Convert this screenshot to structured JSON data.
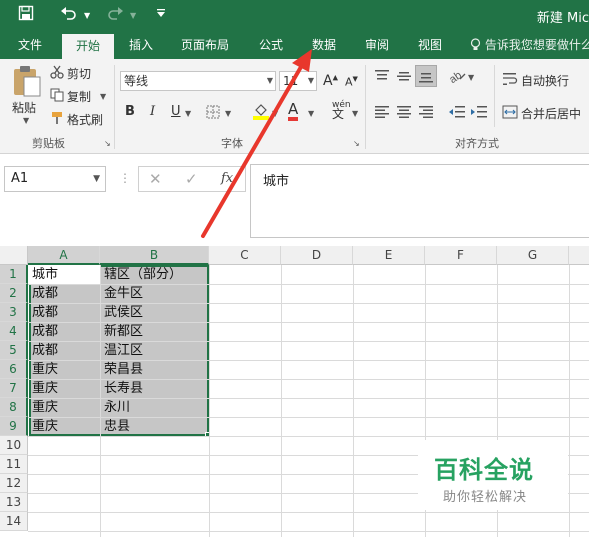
{
  "window": {
    "title": "新建 Mic"
  },
  "quick_access": {
    "save_icon": "save-icon",
    "undo_icon": "undo-icon",
    "redo_icon": "redo-icon",
    "customize_icon": "customize-icon"
  },
  "tabs": [
    {
      "label": "文件"
    },
    {
      "label": "开始"
    },
    {
      "label": "插入"
    },
    {
      "label": "页面布局"
    },
    {
      "label": "公式"
    },
    {
      "label": "数据"
    },
    {
      "label": "审阅"
    },
    {
      "label": "视图"
    }
  ],
  "tell_me": "告诉我您想要做什么",
  "ribbon": {
    "clipboard": {
      "paste": "粘贴",
      "cut": "剪切",
      "copy": "复制",
      "format_painter": "格式刷",
      "label": "剪贴板"
    },
    "font": {
      "name": "等线",
      "size": "11",
      "bold": "B",
      "italic": "I",
      "underline": "U",
      "font_color": "A",
      "phonetic": "wén",
      "label": "字体",
      "grow": "A",
      "shrink": "A"
    },
    "alignment": {
      "wrap": "自动换行",
      "merge": "合并后居中",
      "label": "对齐方式"
    }
  },
  "formula_bar": {
    "name_box": "A1",
    "fx": "fx",
    "cancel": "✕",
    "enter": "✓",
    "formula": "城市"
  },
  "grid": {
    "columns": [
      "A",
      "B",
      "C",
      "D",
      "E",
      "F",
      "G"
    ],
    "rows": [
      "1",
      "2",
      "3",
      "4",
      "5",
      "6",
      "7",
      "8",
      "9",
      "10",
      "11",
      "12",
      "13",
      "14"
    ],
    "cells": [
      {
        "a": "城市",
        "b": "辖区（部分）"
      },
      {
        "a": "成都",
        "b": "金牛区"
      },
      {
        "a": "成都",
        "b": "武侯区"
      },
      {
        "a": "成都",
        "b": "新都区"
      },
      {
        "a": "成都",
        "b": "温江区"
      },
      {
        "a": "重庆",
        "b": "荣昌县"
      },
      {
        "a": "重庆",
        "b": "长寿县"
      },
      {
        "a": "重庆",
        "b": "永川"
      },
      {
        "a": "重庆",
        "b": "忠县"
      }
    ]
  },
  "watermark": {
    "title": "百科全说",
    "subtitle": "助你轻松解决"
  },
  "colors": {
    "excel_green": "#217346",
    "arrow_red": "#e8372c",
    "watermark_green": "#27a261"
  }
}
